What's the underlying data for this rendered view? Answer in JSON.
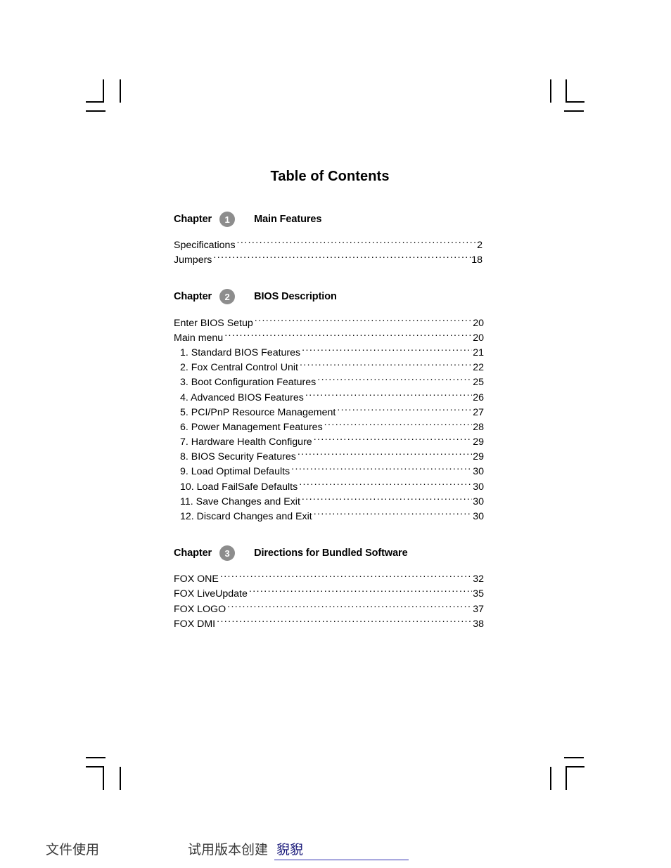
{
  "document": {
    "title": "Table of Contents"
  },
  "chapters": [
    {
      "word": "Chapter",
      "number": "1",
      "title": "Main Features",
      "entries": [
        {
          "label": "Specifications",
          "page": "2"
        },
        {
          "label": "Jumpers",
          "page": "18"
        }
      ]
    },
    {
      "word": "Chapter",
      "number": "2",
      "title": "BIOS Description",
      "entries": [
        {
          "label": "Enter BIOS Setup",
          "page": "20"
        },
        {
          "label": "Main menu",
          "page": "20"
        },
        {
          "label": "1. Standard BIOS Features",
          "page": "21"
        },
        {
          "label": "2. Fox Central Control Unit",
          "page": "22"
        },
        {
          "label": "3. Boot Configuration Features",
          "page": "25"
        },
        {
          "label": "4. Advanced BIOS Features",
          "page": "26"
        },
        {
          "label": "5. PCI/PnP Resource Management",
          "page": "27"
        },
        {
          "label": "6. Power Management Features",
          "page": "28"
        },
        {
          "label": "7. Hardware Health Configure",
          "page": "29"
        },
        {
          "label": "8. BIOS Security Features",
          "page": "29"
        },
        {
          "label": "9. Load  Optimal Defaults",
          "page": "30"
        },
        {
          "label": "10. Load FailSafe Defaults",
          "page": "30"
        },
        {
          "label": "11. Save Changes and Exit",
          "page": "30"
        },
        {
          "label": "12. Discard Changes and Exit",
          "page": "30"
        }
      ]
    },
    {
      "word": "Chapter",
      "number": "3",
      "title": "Directions for Bundled Software",
      "entries": [
        {
          "label": "FOX ONE",
          "page": "32"
        },
        {
          "label": "FOX LiveUpdate",
          "page": "35"
        },
        {
          "label": "FOX LOGO",
          "page": "37"
        },
        {
          "label": "FOX DMI",
          "page": "38"
        }
      ]
    }
  ],
  "footer": {
    "left": "文件使用",
    "middle": "试用版本创建",
    "name": "貎貎"
  },
  "colors": {
    "badge_gray": "#8d8d8d",
    "footer_link": "#2b2bb0",
    "text": "#000000"
  }
}
